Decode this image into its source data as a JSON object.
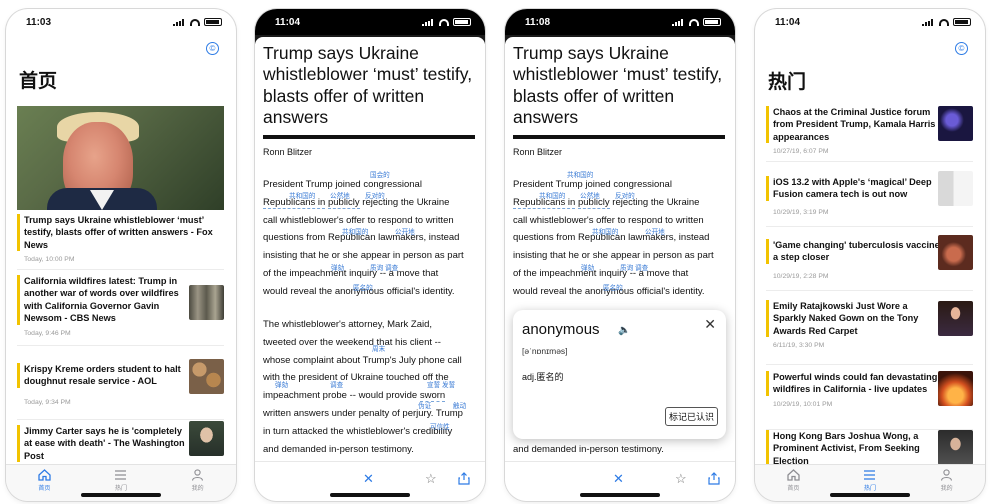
{
  "statusbar": {
    "times": [
      "11:03",
      "11:04",
      "11:08",
      "11:04"
    ]
  },
  "screen1": {
    "title": "首页",
    "items": [
      {
        "headline": "Trump says Ukraine whistleblower ‘must’ testify, blasts offer of written answers - Fox News",
        "time": "Today, 10:00 PM"
      },
      {
        "headline": "California wildfires latest: Trump in another war of words over wildfires with California Governor Gavin Newsom - CBS News",
        "time": "Today, 9:46 PM"
      },
      {
        "headline": "Krispy Kreme orders student to halt doughnut resale service - AOL",
        "time": "Today, 9:34 PM"
      },
      {
        "headline": "Jimmy Carter says he is 'completely at ease with death' - The Washington Post",
        "time": ""
      }
    ]
  },
  "tabs": {
    "home": "首页",
    "hot": "热门",
    "mine": "我的"
  },
  "article": {
    "title": "Trump says Ukraine whistleblower ‘must’ testify, blasts offer of written answers",
    "author": "Ronn Blitzer",
    "p1": [
      "President Trump joined congressional",
      "Republicans in",
      "publicly",
      "rejecting the Ukraine",
      "call whistleblower's offer to respond to written",
      "questions from Republican lawmakers, instead",
      "insisting that he or she appear in person as part",
      "of the impeachment inquiry -- a move that",
      "would reveal the anonymous official's identity."
    ],
    "p2": [
      "The whistleblower's attorney, Mark Zaid,",
      "tweeted over the weekend that his client --",
      "whose complaint about Trump's July phone call",
      "with the president of Ukraine touched off the",
      "impeachment probe -- would provide",
      "sworn",
      "written answers under penalty of perjury. Trump",
      "in turn attacked the whistleblower's credibility",
      "and demanded in-person testimony."
    ],
    "glosses": {
      "congressional": "国会的",
      "republicans": "共和国的",
      "publicly": "公然地",
      "call": "公开地",
      "questions": "共和国的",
      "rejecting": "反对的",
      "lawmakers": "立法者",
      "insisting": "坚持",
      "appear": "出现",
      "person": "亲自",
      "impeachment": "弹劾",
      "inquiry": "质询 调查",
      "anonymous": "匿名的",
      "weekend": "周末",
      "touched": "触动",
      "probe": "调查",
      "sworn": "宣誓 发誓",
      "perjury": "伪证",
      "credibility": "可信性"
    }
  },
  "popup": {
    "word": "anonymous",
    "pron": "[əˈnɒnɪməs]",
    "definition": "adj.匿名的",
    "button": "标记已认识"
  },
  "screen4": {
    "title": "热门",
    "items": [
      {
        "headline": "Chaos at the Criminal Justice forum from President Trump, Kamala Harris appearances",
        "time": "10/27/19, 6:07 PM"
      },
      {
        "headline": "iOS 13.2 with Apple's ‘magical’ Deep Fusion camera tech is out now",
        "time": "10/29/19, 3:19 PM"
      },
      {
        "headline": "'Game changing' tuberculosis vaccine a step closer",
        "time": "10/29/19, 2:28 PM"
      },
      {
        "headline": "Emily Ratajkowski Just Wore a Sparkly Naked Gown on the Tony Awards Red Carpet",
        "time": "6/11/19, 3:30 PM"
      },
      {
        "headline": "Powerful winds could fan devastating wildfires in California - live updates",
        "time": "10/29/19, 10:01 PM"
      },
      {
        "headline": "Hong Kong Bars Joshua Wong, a Prominent Activist, From Seeking Election",
        "time": ""
      }
    ]
  }
}
